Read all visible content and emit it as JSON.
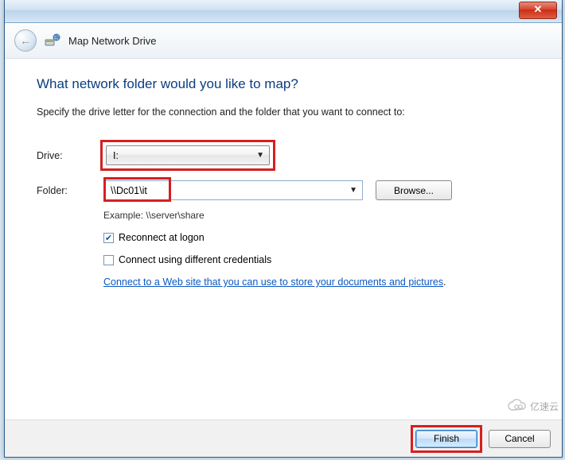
{
  "titlebar": {
    "close_glyph": "✕"
  },
  "header": {
    "title": "Map Network Drive"
  },
  "main": {
    "heading": "What network folder would you like to map?",
    "subtext": "Specify the drive letter for the connection and the folder that you want to connect to:",
    "drive_label": "Drive:",
    "drive_value": "I:",
    "folder_label": "Folder:",
    "folder_value": "\\\\Dc01\\it",
    "browse_label": "Browse...",
    "example_text": "Example: \\\\server\\share",
    "reconnect_label": "Reconnect at logon",
    "reconnect_checked": true,
    "diffcred_label": "Connect using different credentials",
    "diffcred_checked": false,
    "weblink_text": "Connect to a Web site that you can use to store your documents and pictures",
    "weblink_suffix": "."
  },
  "footer": {
    "finish_label": "Finish",
    "cancel_label": "Cancel"
  },
  "watermark": {
    "text": "亿速云"
  }
}
